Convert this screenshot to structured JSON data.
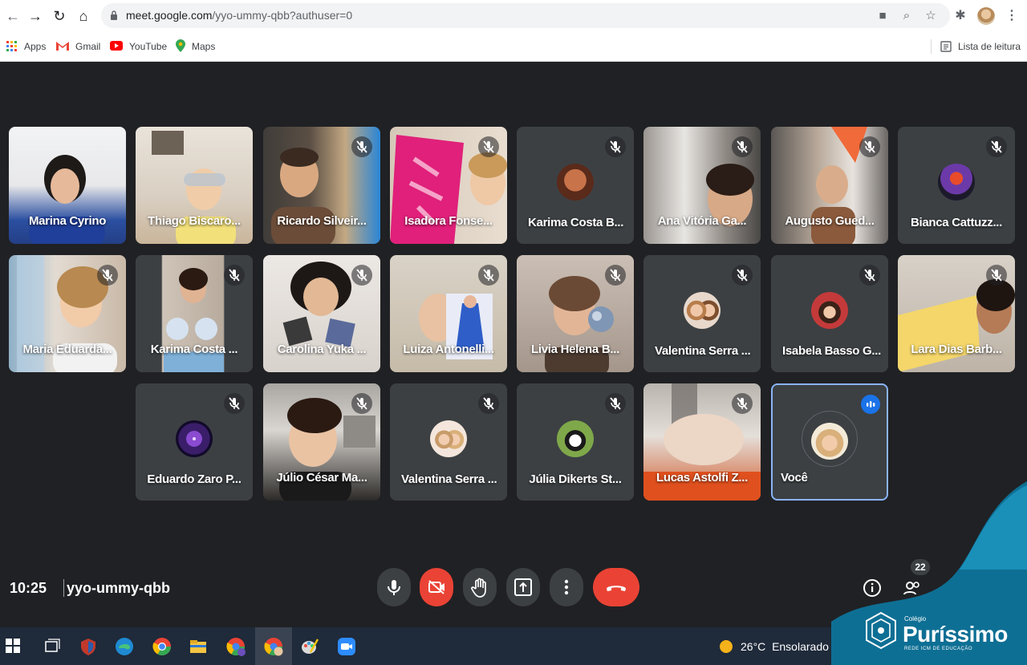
{
  "browser": {
    "url_host": "meet.google.com",
    "url_path": "/yyo-ummy-qbb?authuser=0",
    "bookmarks": [
      "Apps",
      "Gmail",
      "YouTube",
      "Maps"
    ],
    "reading_list": "Lista de leitura"
  },
  "meeting": {
    "time": "10:25",
    "code": "yyo-ummy-qbb",
    "participant_count": "22"
  },
  "participants": [
    {
      "name": "Marina Cyrino"
    },
    {
      "name": "Thiago Biscaro..."
    },
    {
      "name": "Ricardo Silveir..."
    },
    {
      "name": "Isadora Fonse..."
    },
    {
      "name": "Karima Costa B..."
    },
    {
      "name": "Ana Vitória Ga..."
    },
    {
      "name": "Augusto Gued..."
    },
    {
      "name": "Bianca Cattuzz..."
    },
    {
      "name": "Maria Eduarda..."
    },
    {
      "name": "Karima Costa ..."
    },
    {
      "name": "Carolina Yuka ..."
    },
    {
      "name": "Luiza Antonelli..."
    },
    {
      "name": "Livia Helena B..."
    },
    {
      "name": "Valentina Serra ..."
    },
    {
      "name": "Isabela Basso G..."
    },
    {
      "name": "Lara Dias Barb..."
    },
    {
      "name": "Eduardo Zaro P..."
    },
    {
      "name": "Júlio César Ma..."
    },
    {
      "name": "Valentina Serra ..."
    },
    {
      "name": "Júlia Dikerts St..."
    },
    {
      "name": "Lucas Astolfi Z..."
    },
    {
      "name": "Você"
    }
  ],
  "taskbar": {
    "temperature": "26°C",
    "weather": "Ensolarado"
  },
  "logo": {
    "small": "Colégio",
    "name": "Puríssimo",
    "sub": "REDE ICM DE EDUCAÇÃO"
  },
  "colors": {
    "meet_bg": "#202124",
    "tile_bg": "#3c4043",
    "end_call": "#ea4335",
    "self_border": "#8ab4f8",
    "logo_teal": "#0e6f94"
  }
}
